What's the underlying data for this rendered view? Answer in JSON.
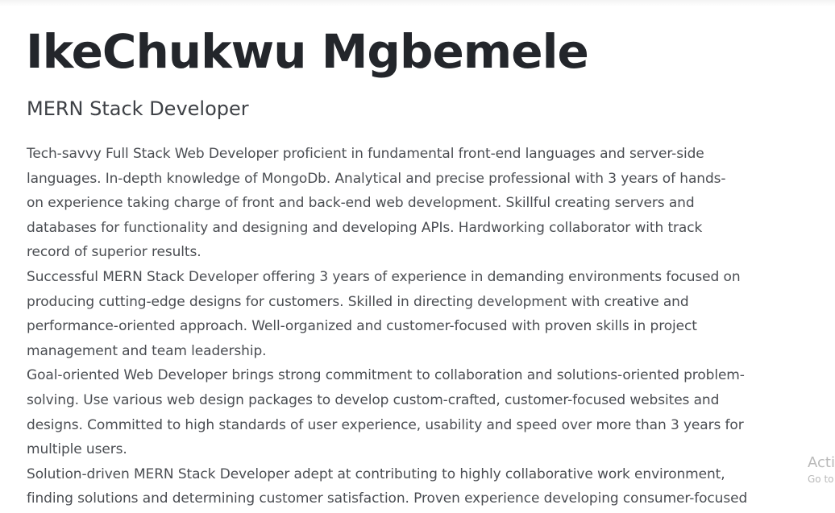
{
  "profile": {
    "name": "IkeChukwu Mgbemele",
    "role": "MERN Stack Developer"
  },
  "summary": {
    "paragraphs": [
      {
        "lines": [
          "Tech-savvy Full Stack Web Developer proficient in fundamental front-end languages and server-side",
          "languages. In-depth knowledge of MongoDb. Analytical and precise professional with 3 years of hands-",
          "on experience taking charge of front and back-end web development. Skillful creating servers and",
          "databases for functionality and designing and developing APIs. Hardworking collaborator with track",
          "record of superior results."
        ]
      },
      {
        "lines": [
          "Successful MERN Stack Developer offering 3 years of experience in demanding environments focused on",
          "producing cutting-edge designs for customers. Skilled in directing development with creative and",
          "performance-oriented approach. Well-organized and customer-focused with proven skills in project",
          "management and team leadership."
        ]
      },
      {
        "lines": [
          "Goal-oriented Web Developer brings strong commitment to collaboration and solutions-oriented problem-",
          "solving. Use various web design packages to develop custom-crafted, customer-focused websites and",
          "designs. Committed to high standards of user experience, usability and speed over more than 3 years for",
          "multiple users."
        ]
      },
      {
        "lines": [
          "Solution-driven MERN Stack Developer adept at contributing to highly collaborative work environment,",
          "finding solutions and determining customer satisfaction. Proven experience developing consumer-focused"
        ]
      }
    ]
  },
  "watermark": {
    "line1": "Acti",
    "line2": "Go to"
  }
}
